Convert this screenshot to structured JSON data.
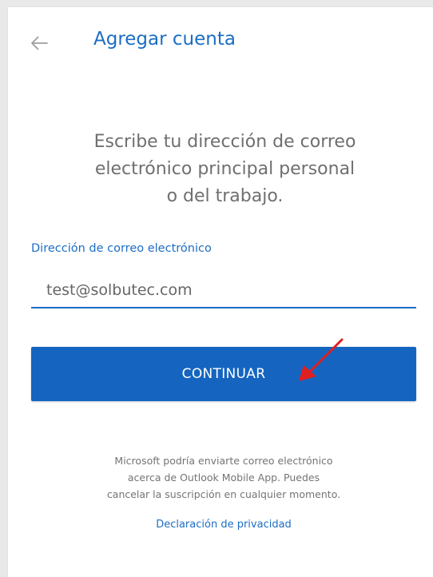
{
  "header": {
    "title": "Agregar cuenta",
    "back_icon": "arrow-left-icon"
  },
  "instructions": {
    "lines": [
      "Escribe tu dirección de correo",
      "electrónico principal personal",
      "o del trabajo."
    ]
  },
  "email_field": {
    "label": "Dirección de correo electrónico",
    "value": "test@solbutec.com"
  },
  "continue_button": {
    "label": "CONTINUAR"
  },
  "disclaimer": {
    "lines": [
      "Microsoft podría enviarte correo electrónico",
      "acerca de Outlook Mobile App. Puedes",
      "cancelar la suscripción en cualquier momento."
    ]
  },
  "privacy_link": {
    "label": "Declaración de privacidad"
  },
  "colors": {
    "accent": "#1c6ec3",
    "button": "#1565c0",
    "annotation_arrow": "#e02020"
  }
}
